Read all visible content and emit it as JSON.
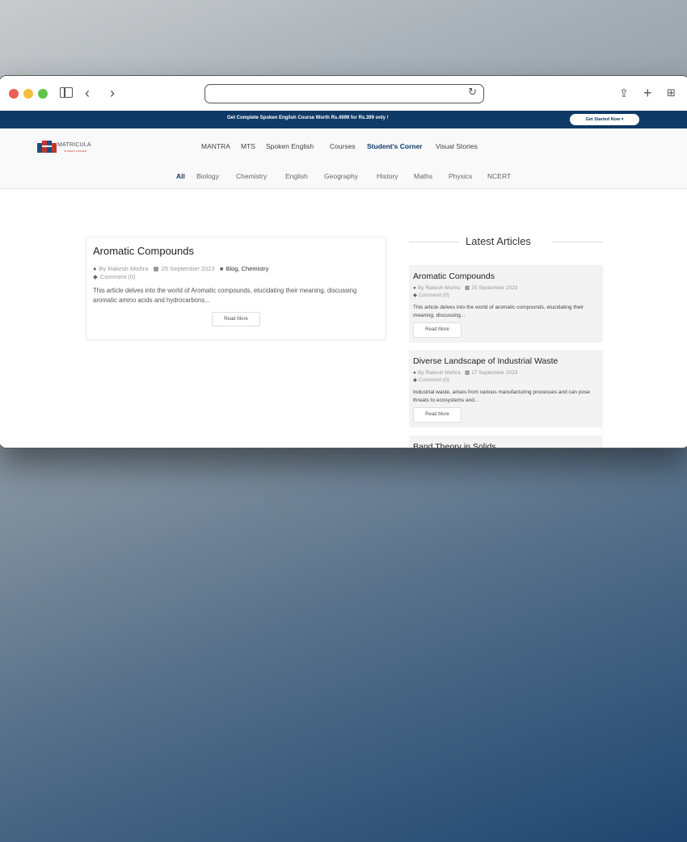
{
  "browser": {
    "address_value": "",
    "icons": [
      "sidebar-icon",
      "back-icon",
      "forward-icon",
      "reload-icon",
      "share-icon",
      "new-tab-icon",
      "tab-overview-icon"
    ]
  },
  "promo": {
    "text": "Get Complete Spoken English Course Worth Rs.4999 for Rs.399 only !",
    "button": "Get Started Now"
  },
  "nav": {
    "logo_text": "MATRICULA",
    "logo_sub": "STUDENT CORNER",
    "items": [
      "MANTRA",
      "MTS",
      "Spoken English",
      "Courses",
      "Student's Corner",
      "Visual Stories"
    ],
    "active": "Student's Corner"
  },
  "categories": {
    "items": [
      "All",
      "Biology",
      "Chemistry",
      "English",
      "Geography",
      "History",
      "Maths",
      "Physics",
      "NCERT"
    ],
    "active": "All"
  },
  "main_post": {
    "title": "Aromatic Compounds",
    "author": "By Rakesh Mishra",
    "date": "25 September 2023",
    "categories": [
      "Blog",
      "Chemistry"
    ],
    "comment": "Comment (0)",
    "excerpt": "This article delves into the world of Aromatic compounds, elucidating their meaning, discussing aromatic amino acids and hydrocarbons...",
    "read_more": "Read More"
  },
  "sidebar": {
    "heading": "Latest Articles",
    "articles": [
      {
        "title": "Aromatic Compounds",
        "author": "By Rakesh Mishra",
        "date": "25 September 2023",
        "comment": "Comment (0)",
        "excerpt": "This article delves into the world of aromatic compounds, elucidating their meaning, discussing...",
        "read_more": "Read More"
      },
      {
        "title": "Diverse Landscape of Industrial Waste",
        "author": "By Rakesh Mishra",
        "date": "17 September 2023",
        "comment": "Comment (0)",
        "excerpt": "Industrial waste, arises from various manufacturing processes and can pose threats to ecosystems and...",
        "read_more": "Read More"
      },
      {
        "title": "Band Theory in Solids"
      }
    ]
  },
  "colors": {
    "brand_navy": "#0f3a66",
    "traffic_red": "#ee5f57",
    "traffic_yellow": "#f4bd3b",
    "traffic_green": "#5ec549"
  }
}
